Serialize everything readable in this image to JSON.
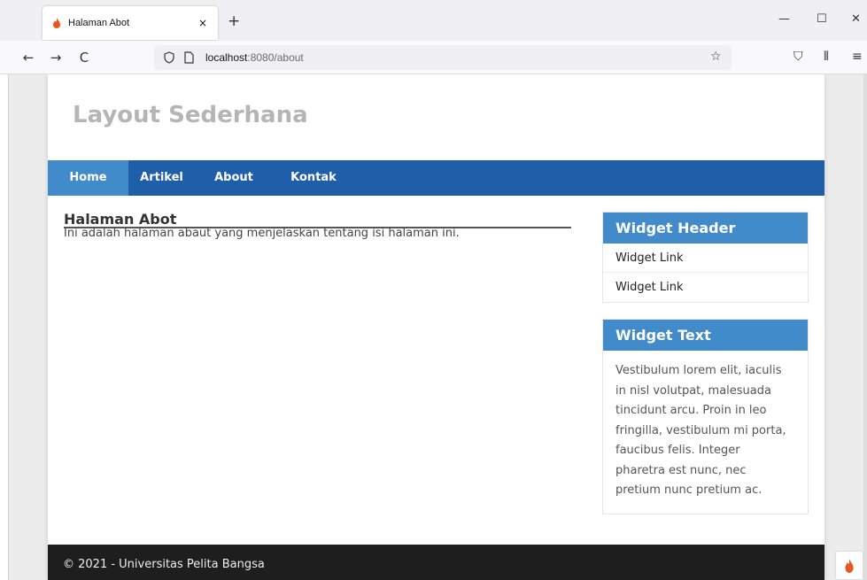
{
  "browser": {
    "tab_title": "Halaman Abot",
    "tab_close": "×",
    "new_tab": "+",
    "url_host": "localhost",
    "url_path": ":8080/about",
    "minimize": "—",
    "maximize": "☐",
    "close": "✕",
    "back": "←",
    "forward": "→",
    "reload": "C",
    "bookmark": "☆",
    "pocket": "⛉",
    "library": "⫴",
    "menu": "≡"
  },
  "site": {
    "title": "Layout Sederhana",
    "nav": [
      {
        "label": "Home",
        "active": true
      },
      {
        "label": "Artikel",
        "active": false
      },
      {
        "label": "About",
        "active": false
      },
      {
        "label": "Kontak",
        "active": false
      }
    ]
  },
  "article": {
    "title": "Halaman Abot",
    "body": "Ini adalah halaman abaut yang menjelaskan tentang isi halaman ini."
  },
  "sidebar": {
    "widget1": {
      "header": "Widget Header",
      "links": [
        "Widget Link",
        "Widget Link"
      ]
    },
    "widget2": {
      "header": "Widget Text",
      "text_lines": [
        "Vestibulum lorem elit, iaculis",
        "in nisl volutpat, malesuada",
        "tincidunt arcu. Proin in leo",
        "fringilla, vestibulum mi porta,",
        "faucibus felis. Integer",
        "pharetra est nunc, nec",
        "pretium nunc pretium ac."
      ]
    }
  },
  "footer": {
    "text": "© 2021 - Universitas Pelita Bangsa"
  },
  "colors": {
    "nav_bg": "#1f5faa",
    "nav_active": "#428bca",
    "widget_header": "#428bca",
    "footer_bg": "#1e1e1e",
    "title_gray": "#b5b5b5"
  }
}
